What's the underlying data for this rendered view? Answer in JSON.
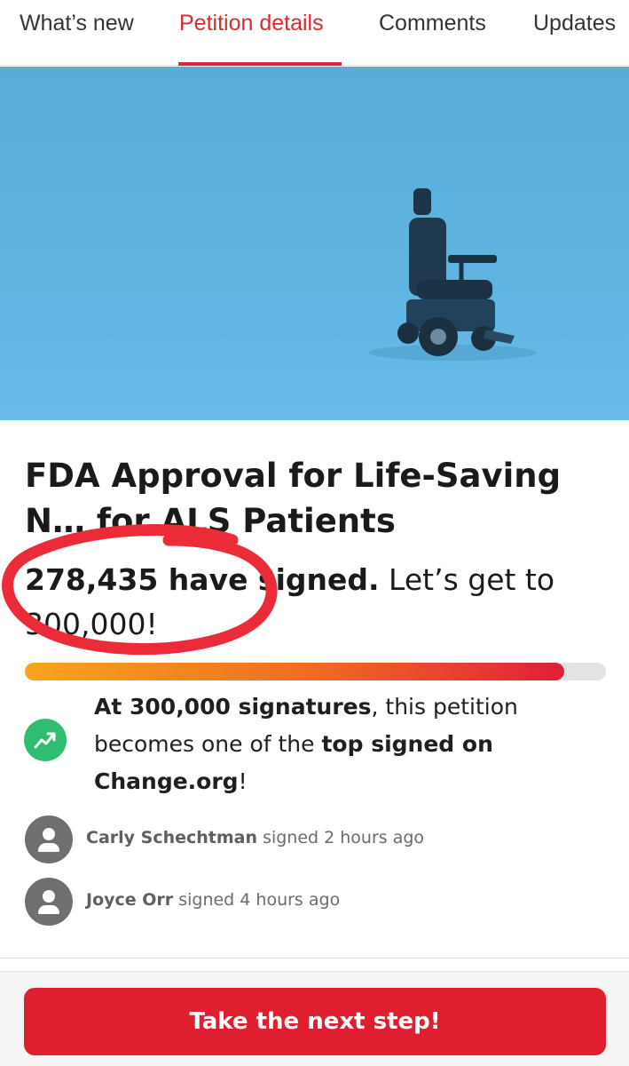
{
  "tabs": [
    {
      "label": "What’s new"
    },
    {
      "label": "Petition details",
      "active": true
    },
    {
      "label": "Comments"
    },
    {
      "label": "Updates"
    }
  ],
  "hero": {
    "icon": "wheelchair-image"
  },
  "petition": {
    "title_line1": "FDA Approval for Life-Saving",
    "title_line2": "N… for ALS Patients",
    "signed_count": "278,435 have signed.",
    "goal_text": " Let’s get to 300,000!",
    "progress": 0.928
  },
  "milestone": {
    "bold1": "At 300,000 signatures",
    "text1": ", this petition becomes one of the ",
    "bold2": "top signed on Change.org",
    "text2": "!",
    "icon": "trending-up-icon"
  },
  "signers": [
    {
      "name": "Carly Schechtman",
      "action": " signed 2 hours ago"
    },
    {
      "name": "Joyce Orr",
      "action": " signed 4 hours ago"
    }
  ],
  "cta": {
    "label": "Take the next step!"
  },
  "colors": {
    "accent": "#d92b2b",
    "cta": "#df1f2f",
    "milestone": "#2fbd72",
    "hero": "#5fb3e1"
  }
}
